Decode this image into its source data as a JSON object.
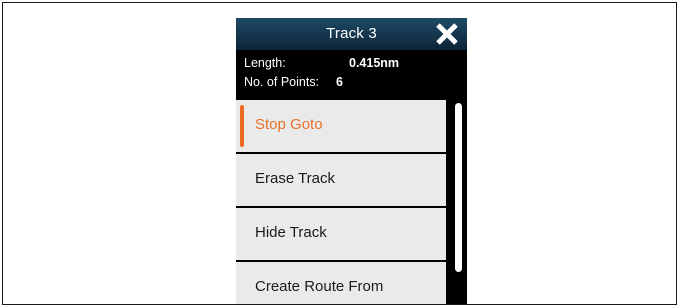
{
  "dialog": {
    "title": "Track 3",
    "close_icon": "close-x-icon"
  },
  "info": {
    "length_label": "Length:",
    "length_value": "0.415nm",
    "points_label": "No. of Points:",
    "points_value": "6"
  },
  "menu": {
    "items": [
      {
        "label": "Stop Goto",
        "selected": true
      },
      {
        "label": "Erase Track",
        "selected": false
      },
      {
        "label": "Hide Track",
        "selected": false
      },
      {
        "label": "Create Route From",
        "selected": false
      }
    ]
  },
  "colors": {
    "header_top": "#1f4a66",
    "header_bottom": "#0c2436",
    "accent": "#ee6a22",
    "menu_bg": "#eaeaea",
    "panel_bg": "#000000"
  }
}
